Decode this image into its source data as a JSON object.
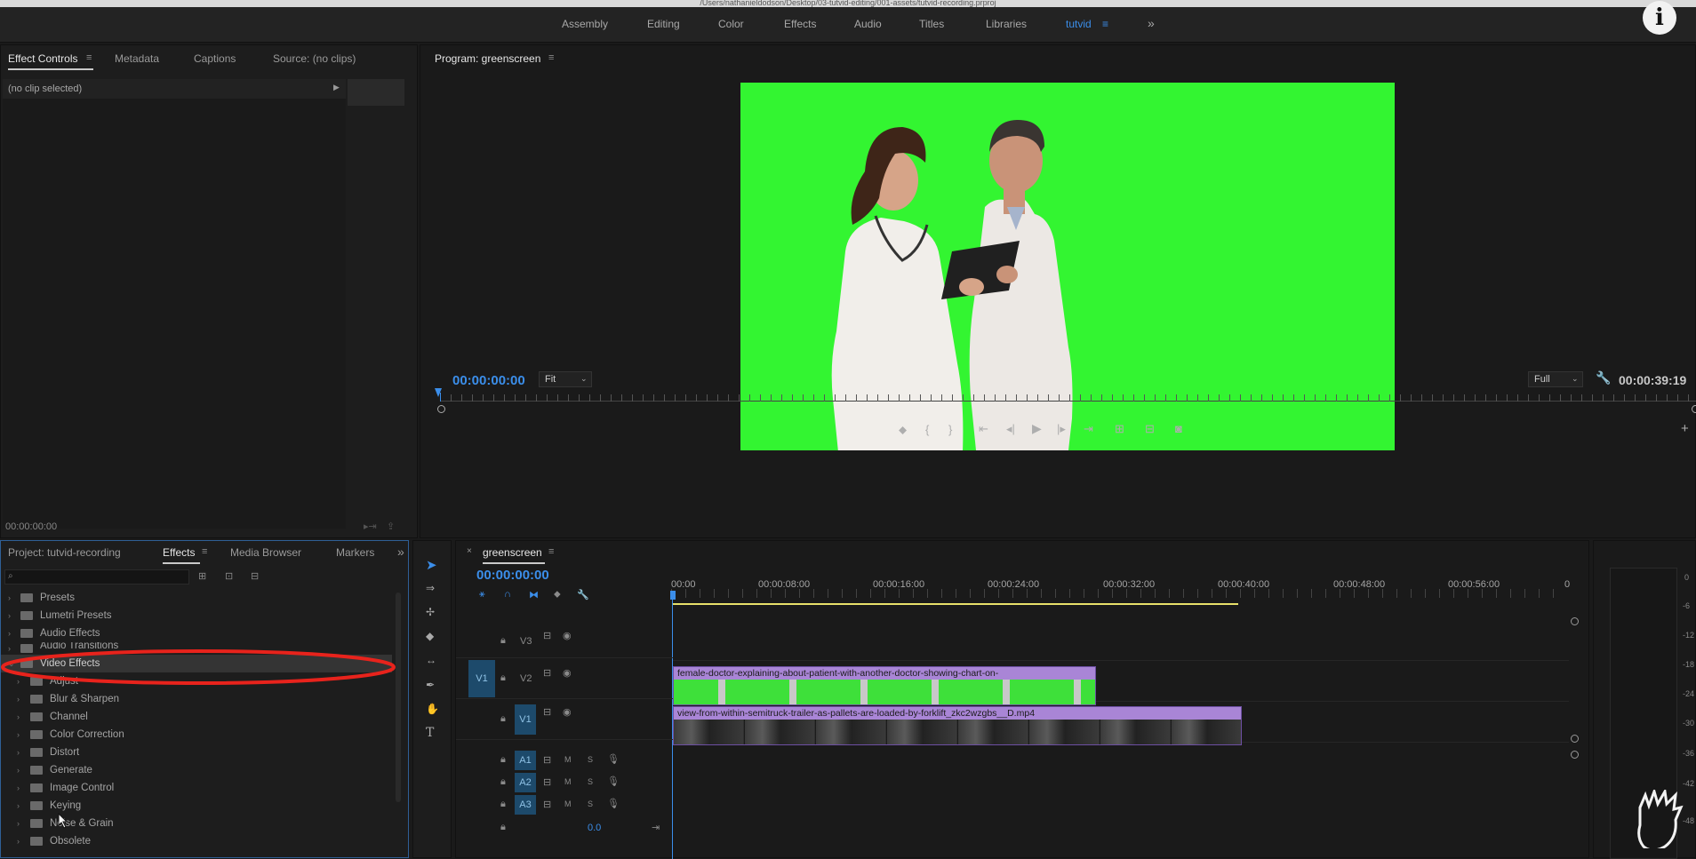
{
  "window": {
    "title": "/Users/nathanieldodson/Desktop/03-tutvid-editing/001-assets/tutvid-recording.prproj"
  },
  "workspaces": [
    {
      "label": "Assembly"
    },
    {
      "label": "Editing"
    },
    {
      "label": "Color"
    },
    {
      "label": "Effects"
    },
    {
      "label": "Audio"
    },
    {
      "label": "Titles"
    },
    {
      "label": "Libraries"
    },
    {
      "label": "tutvid"
    }
  ],
  "workspaces_more": "»",
  "info_badge": "i",
  "effect_controls": {
    "tabs": [
      "Effect Controls",
      "Metadata",
      "Captions",
      "Source: (no clips)"
    ],
    "no_clip": "(no clip selected)",
    "timecode": "00:00:00:00"
  },
  "program": {
    "title": "Program: greenscreen",
    "timecode": "00:00:00:00",
    "fit": "Fit",
    "quality": "Full",
    "duration": "00:00:39:19",
    "background_color": "#33f531"
  },
  "project_panel": {
    "tabs": [
      "Project: tutvid-recording",
      "Effects",
      "Media Browser",
      "Markers"
    ],
    "more": "»",
    "search_placeholder": "",
    "tree": [
      {
        "label": "Presets",
        "level": 0
      },
      {
        "label": "Lumetri Presets",
        "level": 0
      },
      {
        "label": "Audio Effects",
        "level": 0
      },
      {
        "label": "Audio Transitions",
        "level": 0
      },
      {
        "label": "Video Effects",
        "level": 0,
        "expanded": true
      },
      {
        "label": "Adjust",
        "level": 1
      },
      {
        "label": "Blur & Sharpen",
        "level": 1
      },
      {
        "label": "Channel",
        "level": 1
      },
      {
        "label": "Color Correction",
        "level": 1
      },
      {
        "label": "Distort",
        "level": 1
      },
      {
        "label": "Generate",
        "level": 1
      },
      {
        "label": "Image Control",
        "level": 1
      },
      {
        "label": "Keying",
        "level": 1
      },
      {
        "label": "Noise & Grain",
        "level": 1
      },
      {
        "label": "Obsolete",
        "level": 1
      }
    ],
    "highlight_color": "#e8231c"
  },
  "timeline": {
    "sequence": "greenscreen",
    "timecode": "00:00:00:00",
    "ruler": [
      "00:00",
      "00:00:08:00",
      "00:00:16:00",
      "00:00:24:00",
      "00:00:32:00",
      "00:00:40:00",
      "00:00:48:00",
      "00:00:56:00",
      "0"
    ],
    "tracks": {
      "v3": "V3",
      "v2": "V2",
      "v1": "V1",
      "v1_source": "V1",
      "a1": "A1",
      "a2": "A2",
      "a3": "A3",
      "mute": "M",
      "solo": "S",
      "master_volume": "0.0"
    },
    "clips": [
      {
        "name": "female-doctor-explaining-about-patient-with-another-doctor-showing-chart-on-"
      },
      {
        "name": "view-from-within-semitruck-trailer-as-pallets-are-loaded-by-forklift_zkc2wzgbs__D.mp4"
      }
    ],
    "clip_color": "#a985d6"
  },
  "vu_meter": {
    "labels": [
      "0",
      "-6",
      "-12",
      "-18",
      "-24",
      "-30",
      "-36",
      "-42",
      "-48"
    ]
  }
}
